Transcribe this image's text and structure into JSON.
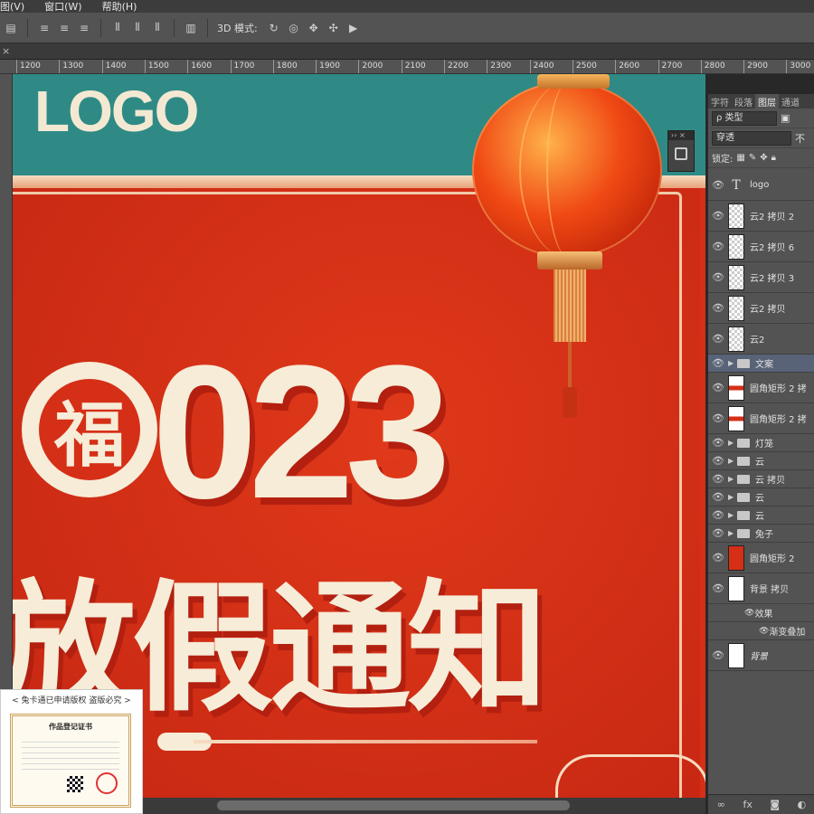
{
  "menubar": {
    "items": [
      "图(V)",
      "窗口(W)",
      "帮助(H)"
    ]
  },
  "optionsbar": {
    "mode_label": "3D 模式:"
  },
  "ruler": {
    "ticks": [
      "1200",
      "1300",
      "1400",
      "1500",
      "1600",
      "1700",
      "1800",
      "1900",
      "2000",
      "2100",
      "2200",
      "2300",
      "2400",
      "2500",
      "2600",
      "2700",
      "2800",
      "2900",
      "3000"
    ]
  },
  "canvas": {
    "logo": "LOGO",
    "year_char": "福",
    "year_digits": "023",
    "headline": "放假通知"
  },
  "panel": {
    "tabs": [
      "字符",
      "段落",
      "图层",
      "通道"
    ],
    "active_tab": "图层",
    "filter_label": "ρ 类型",
    "blend_mode": "穿透",
    "opacity_label": "不",
    "lock_label": "锁定:",
    "layers": [
      {
        "name": "logo",
        "kind": "text"
      },
      {
        "name": "云2 拷贝 2",
        "kind": "bitmap"
      },
      {
        "name": "云2 拷贝 6",
        "kind": "bitmap"
      },
      {
        "name": "云2 拷贝 3",
        "kind": "bitmap"
      },
      {
        "name": "云2 拷贝",
        "kind": "bitmap"
      },
      {
        "name": "云2",
        "kind": "bitmap"
      },
      {
        "name": "文案",
        "kind": "folder",
        "selected": true
      },
      {
        "name": "圆角矩形 2 拷",
        "kind": "stripe"
      },
      {
        "name": "圆角矩形 2 拷",
        "kind": "stripe"
      },
      {
        "name": "灯笼",
        "kind": "folder"
      },
      {
        "name": "云",
        "kind": "folder"
      },
      {
        "name": "云 拷贝",
        "kind": "folder"
      },
      {
        "name": "云",
        "kind": "folder"
      },
      {
        "name": "云",
        "kind": "folder"
      },
      {
        "name": "兔子",
        "kind": "folder"
      },
      {
        "name": "圆角矩形 2",
        "kind": "red"
      },
      {
        "name": "背景 拷贝",
        "kind": "white"
      },
      {
        "name": "效果",
        "kind": "fx"
      },
      {
        "name": "渐变叠加",
        "kind": "fx-sub"
      },
      {
        "name": "背景",
        "kind": "white",
        "italic": true
      }
    ]
  },
  "watermark": {
    "caption": "< 兔卡通已申请版权 盗版必究 >",
    "cert_title": "作品登记证书"
  },
  "colors": {
    "red": "#d62f17",
    "teal": "#2f8a86",
    "cream": "#f6ecd8"
  }
}
